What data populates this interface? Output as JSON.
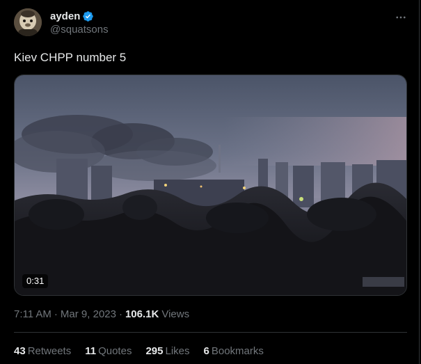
{
  "tweet": {
    "author": {
      "display_name": "ayden",
      "handle": "@squatsons",
      "verified": true,
      "avatar_icon": "avatar-image"
    },
    "more_icon": "more-icon",
    "text": "Kiev CHPP number 5",
    "media": {
      "type": "video",
      "duration": "0:31"
    },
    "meta": {
      "time": "7:11 AM",
      "separator": "·",
      "date": "Mar 9, 2023",
      "views_count": "106.1K",
      "views_label": "Views"
    },
    "stats": [
      {
        "count": "43",
        "label": "Retweets"
      },
      {
        "count": "11",
        "label": "Quotes"
      },
      {
        "count": "295",
        "label": "Likes"
      },
      {
        "count": "6",
        "label": "Bookmarks"
      }
    ]
  },
  "colors": {
    "background": "#000000",
    "text_primary": "#e7e9ea",
    "text_secondary": "#71767b",
    "border": "#2f3336",
    "verified_blue": "#1d9bf0"
  }
}
